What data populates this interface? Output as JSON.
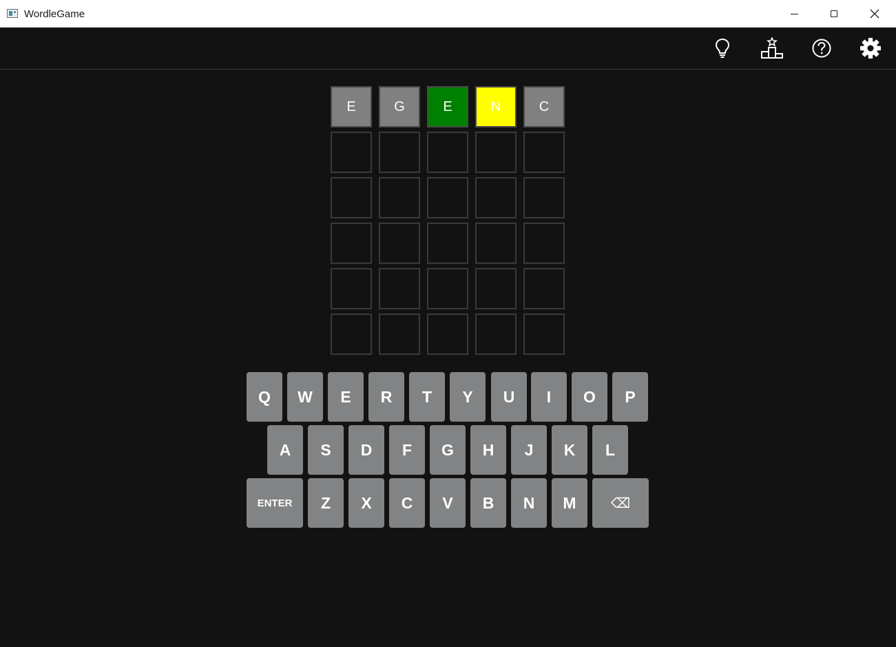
{
  "window": {
    "title": "WordleGame"
  },
  "header_icons": [
    "lightbulb-icon",
    "leaderboard-icon",
    "help-icon",
    "gear-icon"
  ],
  "board": {
    "rows": [
      [
        {
          "letter": "E",
          "state": "absent"
        },
        {
          "letter": "G",
          "state": "absent"
        },
        {
          "letter": "E",
          "state": "correct"
        },
        {
          "letter": "N",
          "state": "present"
        },
        {
          "letter": "C",
          "state": "absent"
        }
      ],
      [
        {
          "letter": "",
          "state": "empty"
        },
        {
          "letter": "",
          "state": "empty"
        },
        {
          "letter": "",
          "state": "empty"
        },
        {
          "letter": "",
          "state": "empty"
        },
        {
          "letter": "",
          "state": "empty"
        }
      ],
      [
        {
          "letter": "",
          "state": "empty"
        },
        {
          "letter": "",
          "state": "empty"
        },
        {
          "letter": "",
          "state": "empty"
        },
        {
          "letter": "",
          "state": "empty"
        },
        {
          "letter": "",
          "state": "empty"
        }
      ],
      [
        {
          "letter": "",
          "state": "empty"
        },
        {
          "letter": "",
          "state": "empty"
        },
        {
          "letter": "",
          "state": "empty"
        },
        {
          "letter": "",
          "state": "empty"
        },
        {
          "letter": "",
          "state": "empty"
        }
      ],
      [
        {
          "letter": "",
          "state": "empty"
        },
        {
          "letter": "",
          "state": "empty"
        },
        {
          "letter": "",
          "state": "empty"
        },
        {
          "letter": "",
          "state": "empty"
        },
        {
          "letter": "",
          "state": "empty"
        }
      ],
      [
        {
          "letter": "",
          "state": "empty"
        },
        {
          "letter": "",
          "state": "empty"
        },
        {
          "letter": "",
          "state": "empty"
        },
        {
          "letter": "",
          "state": "empty"
        },
        {
          "letter": "",
          "state": "empty"
        }
      ]
    ],
    "colors": {
      "absent": "#808080",
      "correct": "#008000",
      "present": "#ffff00",
      "empty_border": "#3a3a3c"
    }
  },
  "keyboard": {
    "row1": [
      "Q",
      "W",
      "E",
      "R",
      "T",
      "Y",
      "U",
      "I",
      "O",
      "P"
    ],
    "row2": [
      "A",
      "S",
      "D",
      "F",
      "G",
      "H",
      "J",
      "K",
      "L"
    ],
    "row3": {
      "enter": "ENTER",
      "letters": [
        "Z",
        "X",
        "C",
        "V",
        "B",
        "N",
        "M"
      ],
      "backspace": "⌫"
    },
    "key_color": "#818384"
  }
}
